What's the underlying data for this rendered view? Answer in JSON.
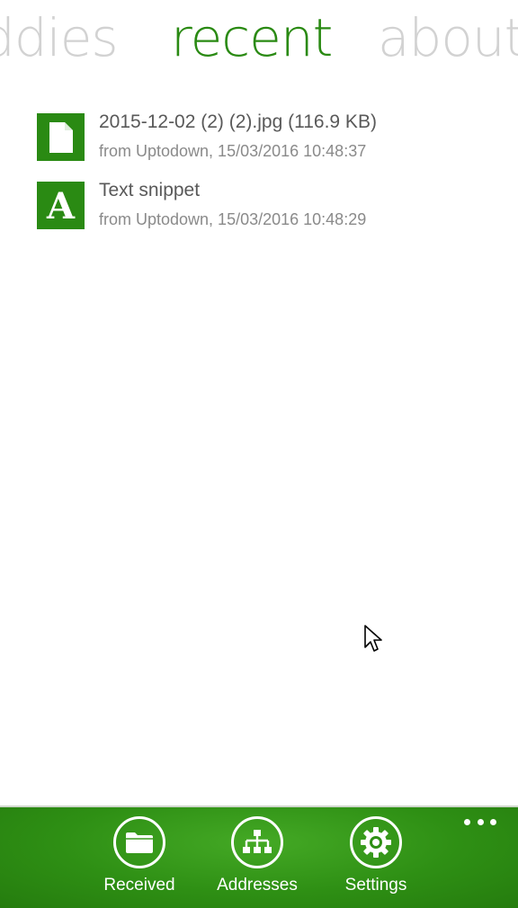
{
  "theme": {
    "accent": "#2a8a13",
    "pivot_inactive": "#d2d2d2",
    "appbar": "#2e8f14"
  },
  "pivot": {
    "prev_label": "ddies",
    "current_label": "recent",
    "next_label": "about"
  },
  "recent": {
    "items": [
      {
        "title": "2015-12-02 (2) (2).jpg (116.9 KB)",
        "subtitle": "from Uptodown, 15/03/2016 10:48:37",
        "icon": "file-icon"
      },
      {
        "title": "Text snippet",
        "subtitle": "from Uptodown, 15/03/2016 10:48:29",
        "icon": "text-snippet-icon",
        "icon_glyph": "A"
      }
    ]
  },
  "appbar": {
    "buttons": [
      {
        "label": "Received",
        "icon": "folder-icon"
      },
      {
        "label": "Addresses",
        "icon": "network-icon"
      },
      {
        "label": "Settings",
        "icon": "gear-icon"
      }
    ],
    "more_icon": "more-icon"
  }
}
